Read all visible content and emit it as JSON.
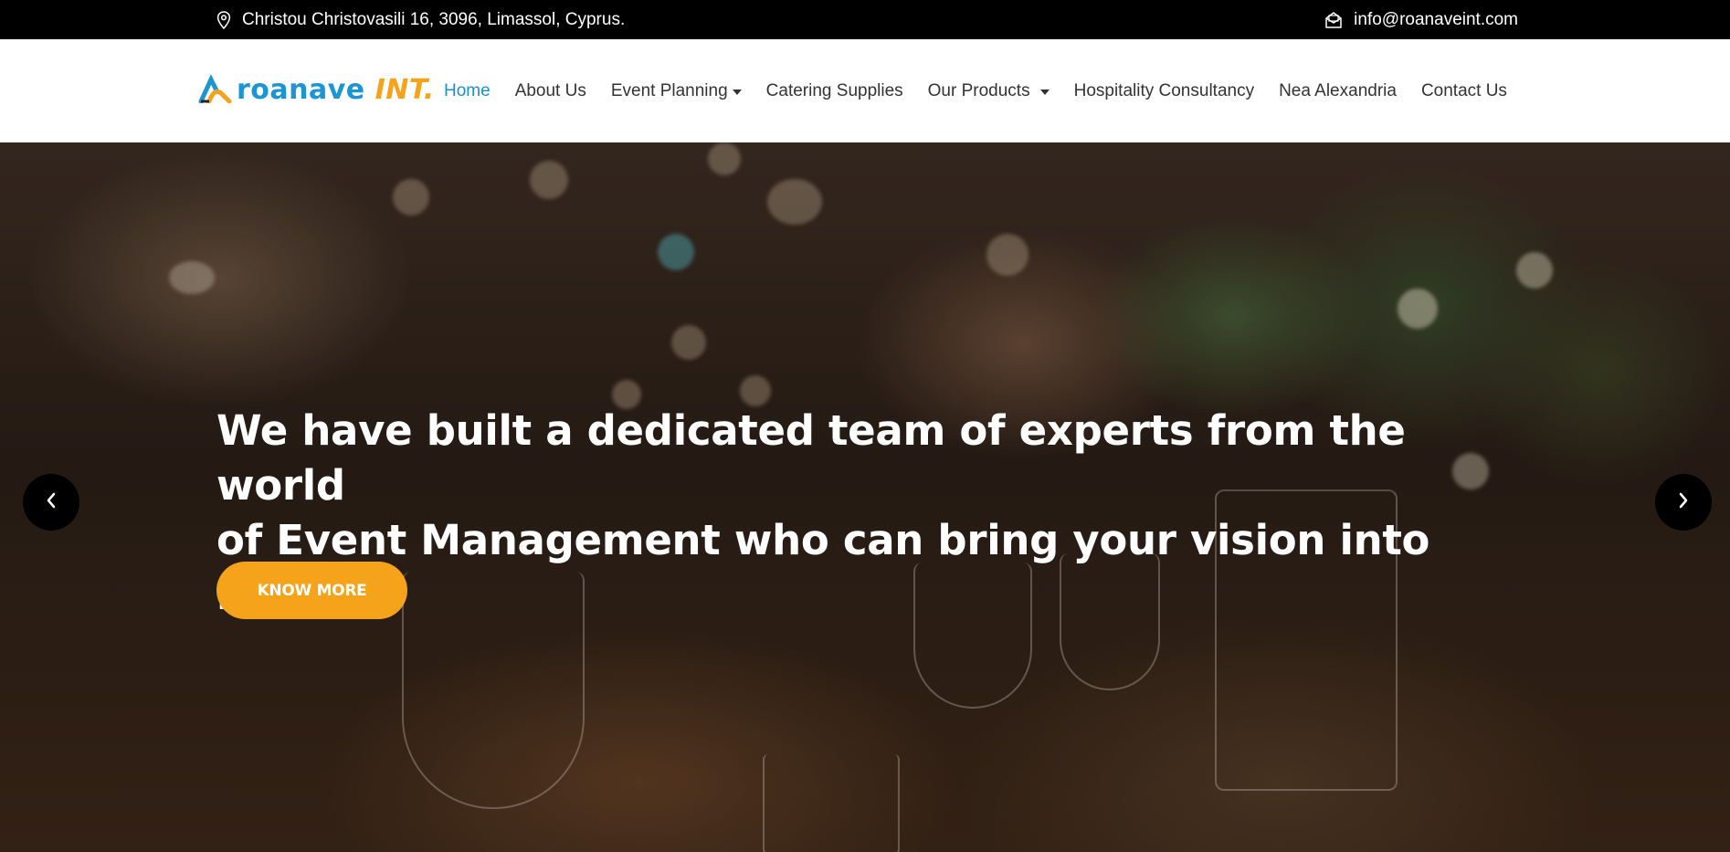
{
  "topbar": {
    "address": "Christou Christovasili 16, 3096, Limassol, Cyprus.",
    "email": "info@roanaveint.com",
    "address_icon": "map-pin-icon",
    "email_icon": "envelope-icon"
  },
  "brand": {
    "logo_text_main": "roanave",
    "logo_text_suffix": "INT.",
    "primary_color": "#1b95d3",
    "accent_color": "#f6a31c"
  },
  "nav": {
    "items": [
      {
        "label": "Home",
        "active": true
      },
      {
        "label": "About Us"
      },
      {
        "label": "Event Planning",
        "dropdown": true
      },
      {
        "label": "Catering Supplies"
      },
      {
        "label": "Our Products",
        "dropdown": true
      },
      {
        "label": "Hospitality Consultancy"
      },
      {
        "label": "Nea Alexandria"
      },
      {
        "label": "Contact Us"
      }
    ]
  },
  "hero": {
    "headline_line1": "We have built a dedicated team of experts from the world",
    "headline_line2": "of Event Management who can bring your vision into reality.",
    "cta_label": "KNOW MORE",
    "prev_icon": "chevron-left-icon",
    "next_icon": "chevron-right-icon"
  }
}
